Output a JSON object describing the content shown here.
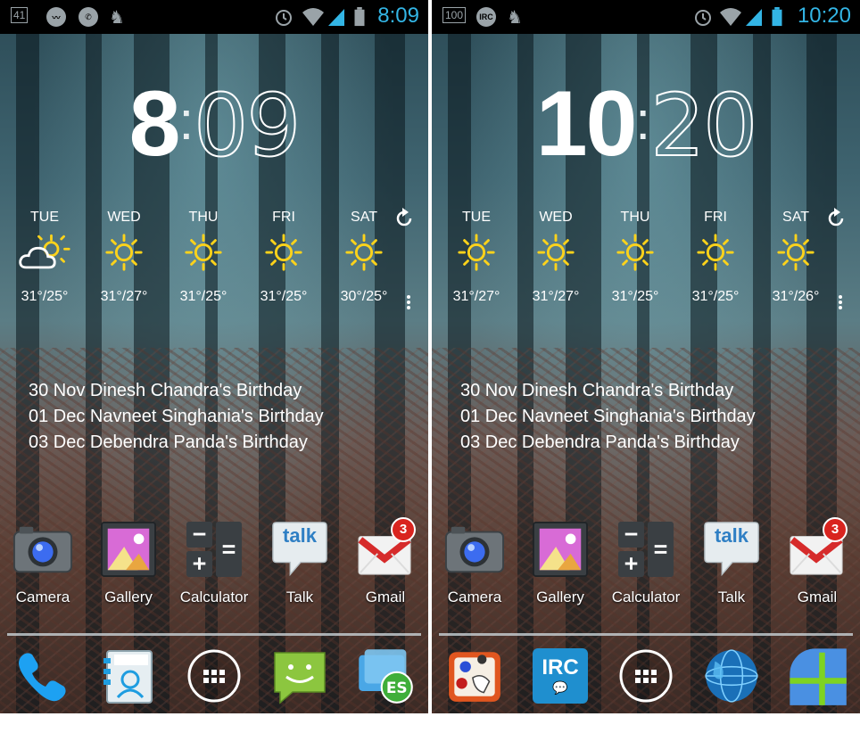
{
  "left": {
    "status": {
      "notifications": [
        "41",
        "activity",
        "whatsapp",
        "camel"
      ],
      "time": "8:09"
    },
    "clock": {
      "hour": "8",
      "separator": ":",
      "minute": "09"
    },
    "forecast": [
      {
        "day": "TUE",
        "icon": "partly-cloudy-icon",
        "temp": "31°/25°"
      },
      {
        "day": "WED",
        "icon": "sun-icon",
        "temp": "31°/27°"
      },
      {
        "day": "THU",
        "icon": "sun-icon",
        "temp": "31°/25°"
      },
      {
        "day": "FRI",
        "icon": "sun-icon",
        "temp": "31°/25°"
      },
      {
        "day": "SAT",
        "icon": "sun-icon",
        "temp": "30°/25°"
      }
    ],
    "events": [
      "30 Nov Dinesh Chandra's Birthday",
      "01 Dec Navneet Singhania's Birthday",
      "03 Dec Debendra Panda's Birthday"
    ],
    "apps": [
      {
        "label": "Camera",
        "icon": "camera-icon"
      },
      {
        "label": "Gallery",
        "icon": "gallery-icon"
      },
      {
        "label": "Calculator",
        "icon": "calculator-icon"
      },
      {
        "label": "Talk",
        "icon": "talk-icon",
        "text": "talk"
      },
      {
        "label": "Gmail",
        "icon": "gmail-icon",
        "badge": "3"
      }
    ],
    "dock": [
      "phone-icon",
      "contacts-icon",
      "app-drawer-icon",
      "messaging-icon",
      "es-file-explorer-icon"
    ]
  },
  "right": {
    "status": {
      "notifications": [
        "100",
        "IRC",
        "camel"
      ],
      "time": "10:20"
    },
    "clock": {
      "hour": "10",
      "separator": ":",
      "minute": "20"
    },
    "forecast": [
      {
        "day": "TUE",
        "icon": "sun-icon",
        "temp": "31°/27°"
      },
      {
        "day": "WED",
        "icon": "sun-icon",
        "temp": "31°/27°"
      },
      {
        "day": "THU",
        "icon": "sun-icon",
        "temp": "31°/25°"
      },
      {
        "day": "FRI",
        "icon": "sun-icon",
        "temp": "31°/25°"
      },
      {
        "day": "SAT",
        "icon": "sun-icon",
        "temp": "31°/26°"
      }
    ],
    "events": [
      "30 Nov Dinesh Chandra's Birthday",
      "01 Dec Navneet Singhania's Birthday",
      "03 Dec Debendra Panda's Birthday"
    ],
    "apps": [
      {
        "label": "Camera",
        "icon": "camera-icon"
      },
      {
        "label": "Gallery",
        "icon": "gallery-icon"
      },
      {
        "label": "Calculator",
        "icon": "calculator-icon"
      },
      {
        "label": "Talk",
        "icon": "talk-icon",
        "text": "talk"
      },
      {
        "label": "Gmail",
        "icon": "gmail-icon",
        "badge": "3"
      }
    ],
    "dock": [
      "planner-icon",
      "irc-icon",
      "app-drawer-icon",
      "globe-icon",
      "quarter-circle-app-icon"
    ],
    "dock_text": {
      "irc": "IRC"
    }
  },
  "colors": {
    "status_time": "#33b5e5",
    "sun": "#ffd31a",
    "accent_blue": "#1f9de0"
  }
}
